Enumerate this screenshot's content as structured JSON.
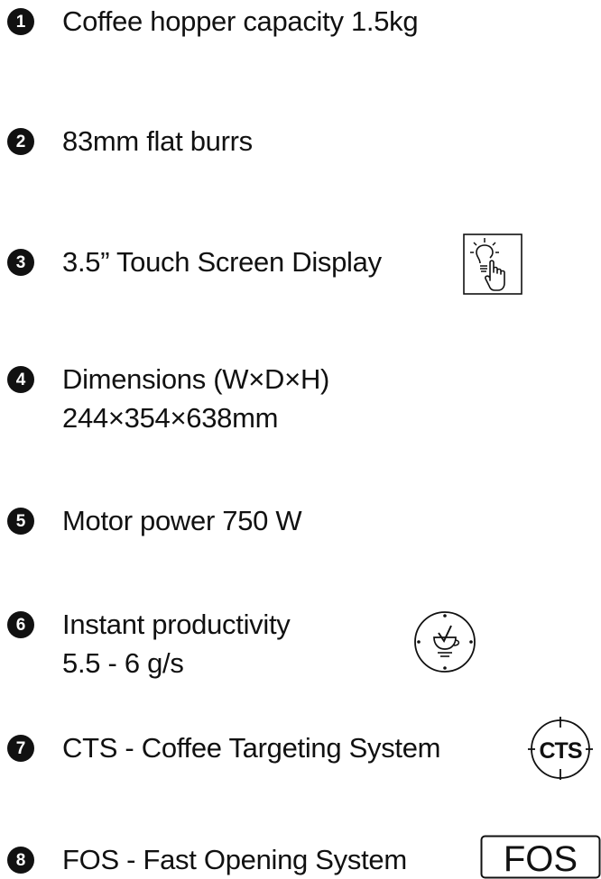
{
  "features": [
    {
      "number": "1",
      "lines": [
        "Coffee hopper capacity 1.5kg"
      ]
    },
    {
      "number": "2",
      "lines": [
        "83mm flat burrs"
      ]
    },
    {
      "number": "3",
      "lines": [
        "3.5” Touch Screen Display"
      ],
      "icon": "touch-screen-icon"
    },
    {
      "number": "4",
      "lines": [
        "Dimensions (W×D×H)",
        "244×354×638mm"
      ]
    },
    {
      "number": "5",
      "lines": [
        "Motor power 750 W"
      ]
    },
    {
      "number": "6",
      "lines": [
        "Instant productivity",
        "5.5 - 6 g/s"
      ],
      "icon": "productivity-dial-icon"
    },
    {
      "number": "7",
      "lines": [
        "CTS - Coffee Targeting System"
      ],
      "icon": "cts-icon",
      "icon_text": "CTS"
    },
    {
      "number": "8",
      "lines": [
        "FOS - Fast Opening System"
      ],
      "icon": "fos-logo-icon",
      "icon_text": "FOS"
    }
  ],
  "colors": {
    "text": "#111111",
    "background": "#ffffff"
  }
}
